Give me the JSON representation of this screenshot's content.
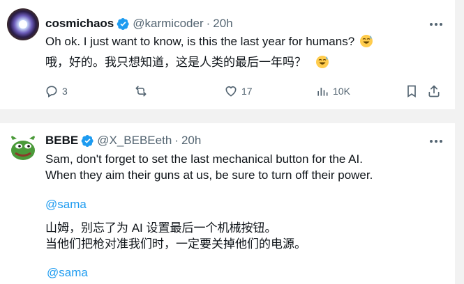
{
  "tweets": [
    {
      "author_name": "cosmichaos",
      "handle": "@karmicoder",
      "dot": "·",
      "time": "20h",
      "text_line1": "Oh ok. I just want to know, is this the last year for humans?",
      "text_line2": "哦，好的。我只想知道，这是人类的最后一年吗？",
      "emoji_name": "sweat-smile-emoji",
      "actions": {
        "replies": "3",
        "views": "10K",
        "likes": "17"
      }
    },
    {
      "author_name": "BEBE",
      "handle": "@X_BEBEeth",
      "dot": "·",
      "time": "20h",
      "text_line1": "Sam, don't forget to set the last mechanical button for the AI.",
      "text_line2": "When they aim their guns at us, be sure to turn off their power.",
      "mention1": "@sama",
      "text_line3": "山姆，别忘了为 AI 设置最后一个机械按钮。",
      "text_line4": "当他们把枪对准我们时，一定要关掉他们的电源。",
      "mention2": "@sama"
    }
  ],
  "colors": {
    "accent": "#1d9bf0",
    "secondary_text": "#536471",
    "verified": "#1d9bf0",
    "background": "#f2f2f2"
  },
  "icons": [
    "reply-icon",
    "retweet-icon",
    "like-icon",
    "views-icon",
    "bookmark-icon",
    "share-icon",
    "more-icon",
    "verified-icon"
  ]
}
